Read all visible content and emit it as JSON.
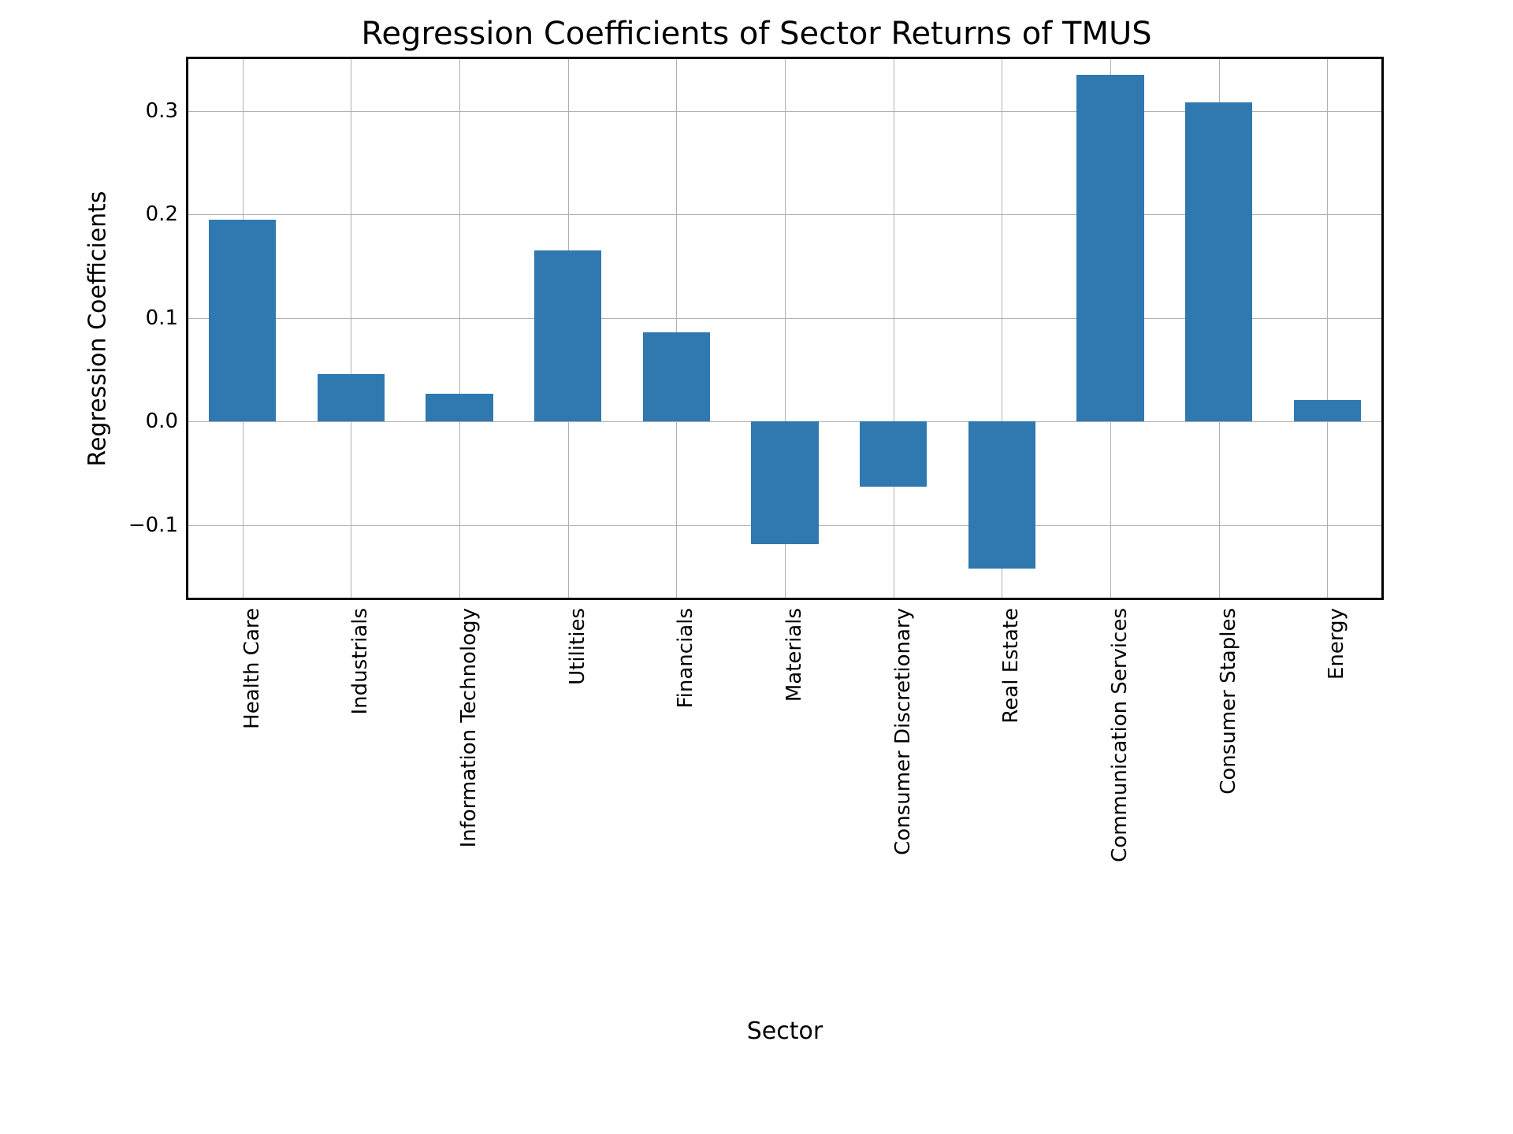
{
  "chart_data": {
    "type": "bar",
    "title": "Regression Coefficients of Sector Returns of TMUS",
    "xlabel": "Sector",
    "ylabel": "Regression Coefficients",
    "categories": [
      "Health Care",
      "Industrials",
      "Information Technology",
      "Utilities",
      "Financials",
      "Materials",
      "Consumer Discretionary",
      "Real Estate",
      "Communication Services",
      "Consumer Staples",
      "Energy"
    ],
    "values": [
      0.195,
      0.046,
      0.027,
      0.165,
      0.086,
      -0.118,
      -0.063,
      -0.142,
      0.335,
      0.308,
      0.021
    ],
    "ylim": [
      -0.17,
      0.35
    ],
    "yticks": [
      -0.1,
      0.0,
      0.1,
      0.2,
      0.3
    ],
    "ytick_labels": [
      "−0.1",
      "0.0",
      "0.1",
      "0.2",
      "0.3"
    ],
    "bar_color": "#2f78b0"
  }
}
